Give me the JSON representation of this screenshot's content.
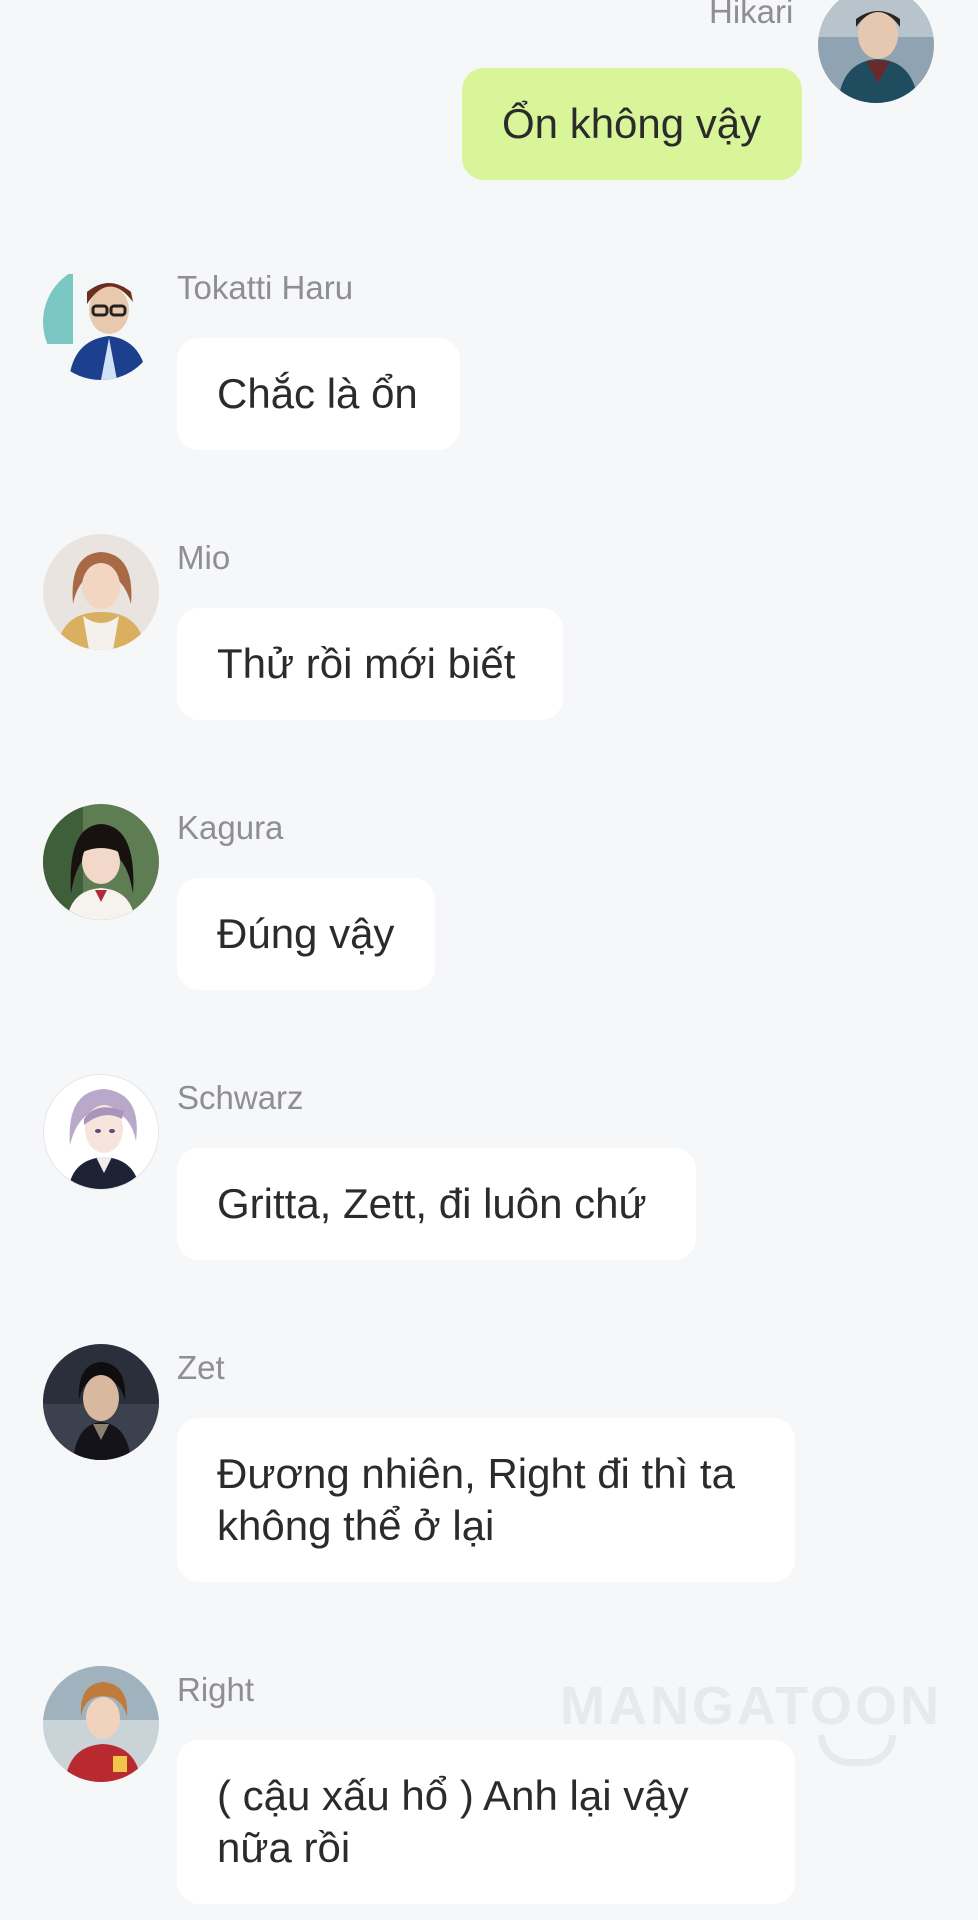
{
  "messages": [
    {
      "sender": "Hikari",
      "text": "Ổn không vậy",
      "mine": true,
      "avatar_icon": "hikari-avatar-icon"
    },
    {
      "sender": "Tokatti Haru",
      "text": "Chắc là ổn",
      "mine": false,
      "avatar_icon": "tokatti-haru-avatar-icon"
    },
    {
      "sender": "Mio",
      "text": "Thử rồi mới biết",
      "mine": false,
      "avatar_icon": "mio-avatar-icon"
    },
    {
      "sender": "Kagura",
      "text": "Đúng vậy",
      "mine": false,
      "avatar_icon": "kagura-avatar-icon"
    },
    {
      "sender": "Schwarz",
      "text": "Gritta, Zett, đi luôn chứ",
      "mine": false,
      "avatar_icon": "schwarz-avatar-icon"
    },
    {
      "sender": "Zet",
      "text_lines": [
        "Đương nhiên, Right đi thì ta",
        "không thể ở lại"
      ],
      "mine": false,
      "avatar_icon": "zet-avatar-icon"
    },
    {
      "sender": "Right",
      "text_lines": [
        "( cậu xấu hổ ) Anh lại vậy",
        "nữa rồi"
      ],
      "mine": false,
      "avatar_icon": "right-avatar-icon"
    }
  ],
  "watermark": "MANGATOON",
  "colors": {
    "background": "#f6f7f9",
    "bubble_mine": "#d8f59a",
    "bubble_other": "#ffffff",
    "sender_name": "#8e8e93",
    "message_text": "#2b2b2b"
  }
}
